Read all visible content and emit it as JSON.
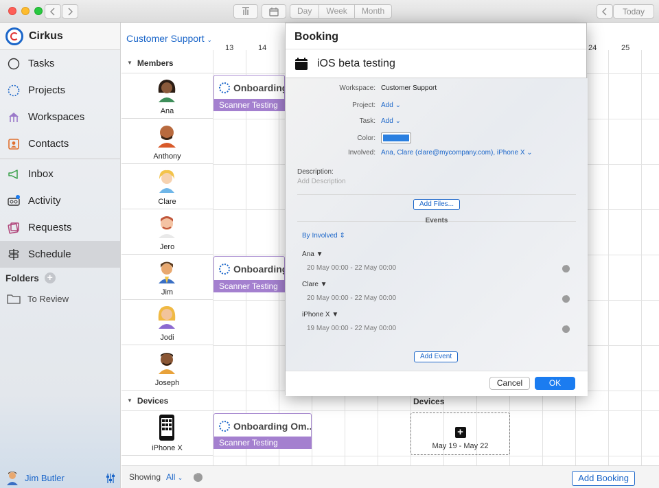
{
  "toolbar": {
    "segments": [
      "Day",
      "Week",
      "Month"
    ],
    "today_label": "Today"
  },
  "sidebar": {
    "app_name": "Cirkus",
    "items": [
      {
        "label": "Tasks",
        "icon": "circle-icon"
      },
      {
        "label": "Projects",
        "icon": "dotted-circle-icon"
      },
      {
        "label": "Workspaces",
        "icon": "carousel-icon"
      },
      {
        "label": "Contacts",
        "icon": "contact-card-icon"
      },
      {
        "label": "Inbox",
        "icon": "megaphone-icon"
      },
      {
        "label": "Activity",
        "icon": "voicemail-icon"
      },
      {
        "label": "Requests",
        "icon": "tickets-icon"
      },
      {
        "label": "Schedule",
        "icon": "signpost-icon"
      }
    ],
    "active": "Schedule",
    "folders_label": "Folders",
    "folder_items": [
      {
        "label": "To Review"
      }
    ],
    "user_name": "Jim Butler"
  },
  "schedule": {
    "workspace": "Customer Support",
    "days": [
      "13",
      "14",
      "24",
      "25"
    ],
    "members_header": "Members",
    "devices_header": "Devices",
    "devices_column_label": "Devices",
    "members": [
      "Ana",
      "Anthony",
      "Clare",
      "Jero",
      "Jim",
      "Jodi",
      "Joseph"
    ],
    "devices": [
      "iPhone X"
    ],
    "bars": {
      "onboarding_short": "Onboarding",
      "onboarding_long": "Onboarding Om...",
      "scanner": "Scanner Testing"
    },
    "add_slot_range": "May 19 - May 22"
  },
  "bottom": {
    "showing_label": "Showing",
    "showing_value": "All",
    "add_booking": "Add Booking"
  },
  "dialog": {
    "title": "Booking",
    "booking_name": "iOS beta testing",
    "fields": {
      "workspace_label": "Workspace:",
      "workspace_value": "Customer Support",
      "project_label": "Project:",
      "project_value": "Add",
      "task_label": "Task:",
      "task_value": "Add",
      "color_label": "Color:",
      "color_value": "#2a7fe0",
      "involved_label": "Involved:",
      "involved_value": "Ana, Clare (clare@mycompany.com), iPhone X"
    },
    "description_label": "Description:",
    "description_placeholder": "Add Description",
    "add_files": "Add Files...",
    "events_header": "Events",
    "group_by": "By Involved",
    "events": [
      {
        "who": "Ana",
        "range": "20 May 00:00 - 22 May 00:00"
      },
      {
        "who": "Clare",
        "range": "20 May 00:00 - 22 May 00:00"
      },
      {
        "who": "iPhone X",
        "range": "19 May 00:00 - 22 May 00:00"
      }
    ],
    "add_event": "Add Event",
    "cancel": "Cancel",
    "ok": "OK"
  },
  "colors": {
    "accent": "#1b66c9",
    "ok_button": "#1b7cf0",
    "booking_bar": "#a480cf"
  }
}
